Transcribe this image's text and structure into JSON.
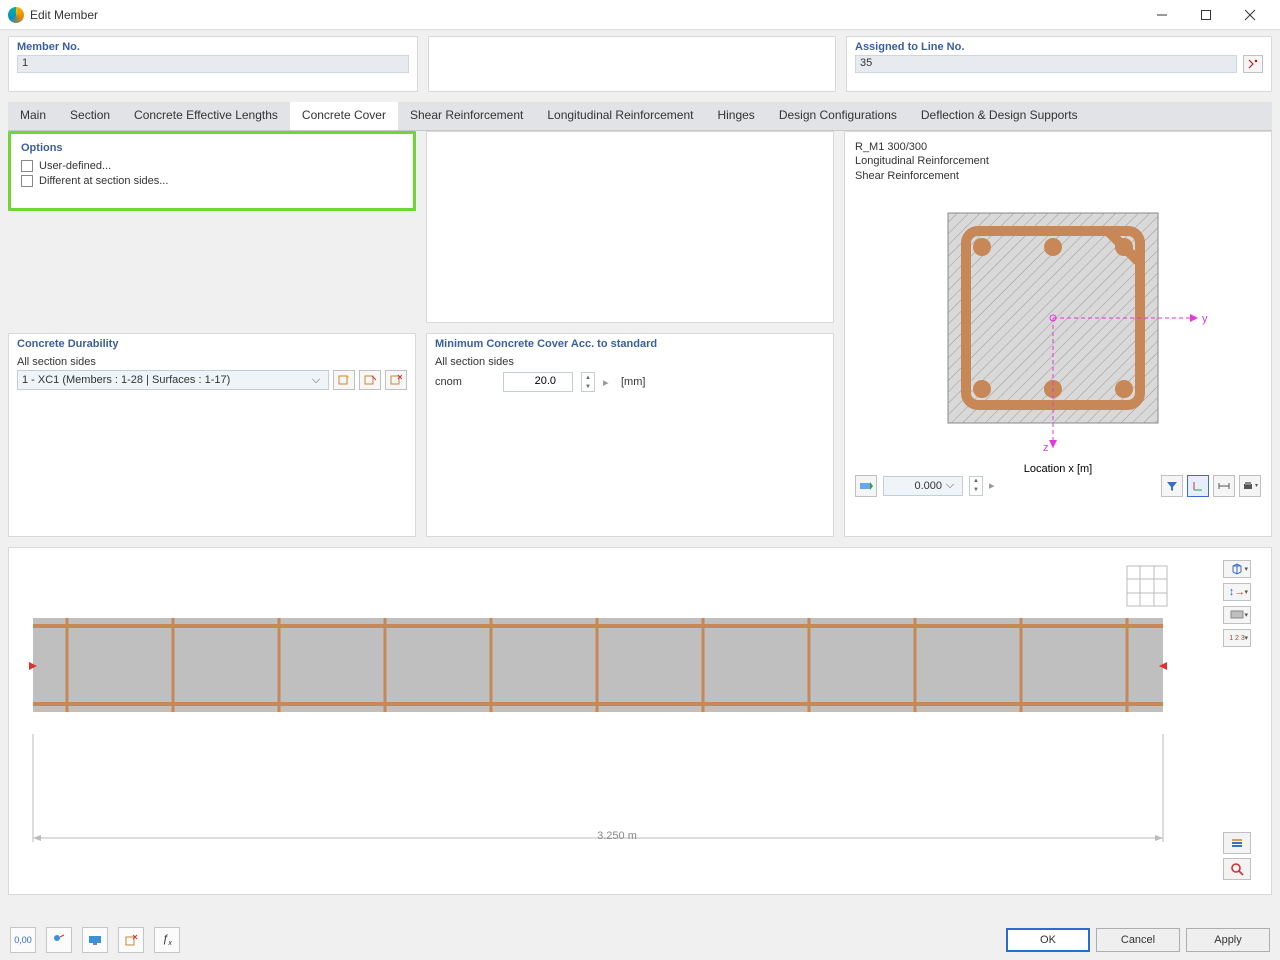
{
  "window": {
    "title": "Edit Member"
  },
  "topPanels": {
    "memberNo": {
      "title": "Member No.",
      "value": "1"
    },
    "assigned": {
      "title": "Assigned to Line No.",
      "value": "35"
    }
  },
  "tabs": [
    "Main",
    "Section",
    "Concrete Effective Lengths",
    "Concrete Cover",
    "Shear Reinforcement",
    "Longitudinal Reinforcement",
    "Hinges",
    "Design Configurations",
    "Deflection & Design Supports"
  ],
  "activeTab": 3,
  "options": {
    "title": "Options",
    "userDefined": {
      "label": "User-defined...",
      "checked": false
    },
    "diffSides": {
      "label": "Different at section sides...",
      "checked": false
    }
  },
  "durability": {
    "title": "Concrete Durability",
    "subhead": "All section sides",
    "combo": "1 - XC1 (Members : 1-28 | Surfaces : 1-17)"
  },
  "minCover": {
    "title": "Minimum Concrete Cover Acc. to standard",
    "subhead": "All section sides",
    "paramLabel": "cnom",
    "value": "20.0",
    "unit": "[mm]"
  },
  "sectionView": {
    "line1": "R_M1 300/300",
    "line2": "Longitudinal Reinforcement",
    "line3": "Shear Reinforcement",
    "locationLabel": "Location x [m]",
    "locationValue": "0.000"
  },
  "elevation": {
    "length": "3.250 m"
  },
  "buttons": {
    "ok": "OK",
    "cancel": "Cancel",
    "apply": "Apply"
  }
}
